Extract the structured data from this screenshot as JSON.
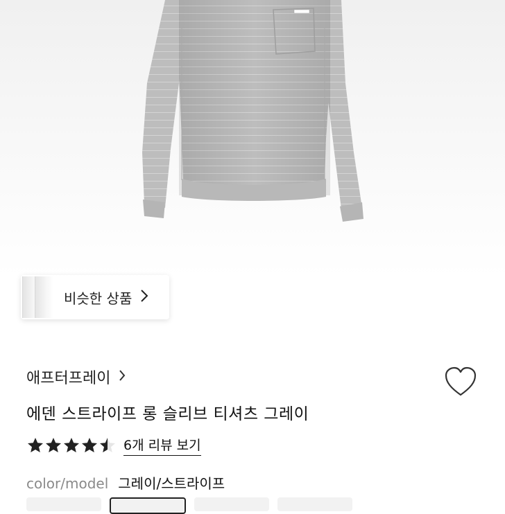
{
  "product_image": {
    "alt_icon": "sweatshirt-image"
  },
  "similar_products": {
    "label": "비슷한 상품",
    "chevron": "chevron-right-icon"
  },
  "brand": {
    "name": "애프터프레이",
    "chevron": "chevron-right-icon"
  },
  "wishlist": {
    "icon": "heart-icon"
  },
  "product": {
    "title": "에덴 스트라이프 롱 슬리브 티셔츠 그레이"
  },
  "rating": {
    "stars": 4.5,
    "max": 5,
    "review_link": "6개 리뷰 보기"
  },
  "option": {
    "key": "color/model",
    "value": "그레이/스트라이프"
  },
  "colors": {
    "star": "#222222",
    "text": "#111111",
    "muted": "#8a8a8a"
  }
}
